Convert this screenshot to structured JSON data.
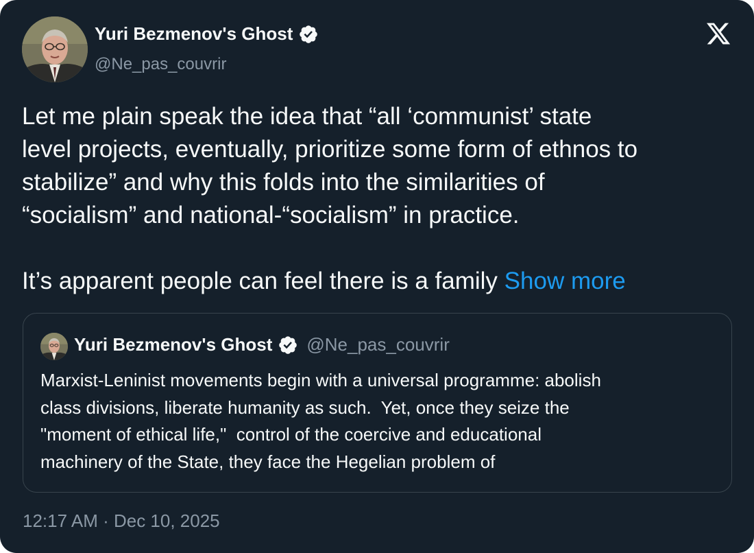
{
  "author": {
    "display_name": "Yuri Bezmenov's Ghost",
    "handle": "@Ne_pas_couvrir",
    "verified": true,
    "avatar_icon": "profile-photo"
  },
  "platform_icon": "x-logo",
  "tweet": {
    "lines_p1": [
      "Let me plain speak the idea that “all ‘communist’ state",
      "level projects, eventually, prioritize some form of ethnos to",
      "stabilize” and why this folds into the similarities of",
      "“socialism” and national-“socialism” in practice."
    ],
    "line_p2": "It’s apparent people can feel there is a family ",
    "show_more": "Show more"
  },
  "quoted_tweet": {
    "display_name": "Yuri Bezmenov's Ghost",
    "handle": "@Ne_pas_couvrir",
    "verified": true,
    "lines": [
      "Marxist-Leninist movements begin with a universal programme: abolish",
      "class divisions, liberate humanity as such.  Yet, once they seize the",
      "\"moment of ethical life,\"  control of the coercive and educational",
      "machinery of the State, they face the Hegelian problem of"
    ]
  },
  "timestamp": "12:17 AM · Dec 10, 2025",
  "colors": {
    "background": "#15202b",
    "text": "#f7f9f9",
    "muted": "#8b98a5",
    "link": "#1d9bf0",
    "border": "#38444d"
  }
}
